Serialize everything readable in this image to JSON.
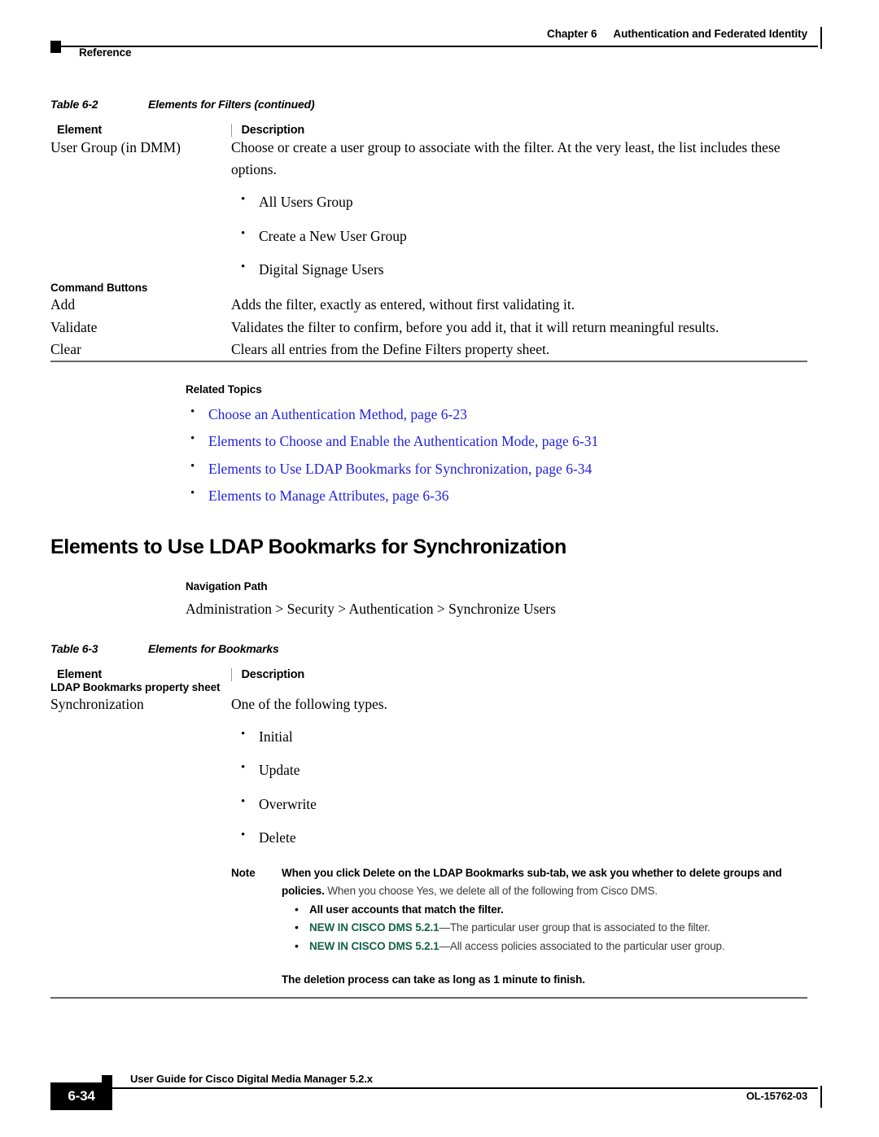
{
  "header": {
    "chapter_number": "Chapter 6",
    "chapter_title": "Authentication and Federated Identity",
    "section_label": "Reference"
  },
  "table_2": {
    "caption_number": "Table 6-2",
    "caption_title": "Elements for Filters (continued)",
    "columns": [
      "Element",
      "Description"
    ],
    "rows": [
      {
        "element": "User Group (in DMM)",
        "description": "Choose or create a user group to associate with the filter. At the very least, the list includes these options.",
        "bullets": [
          "All Users Group",
          "Create a New User Group",
          "Digital Signage Users"
        ]
      }
    ],
    "subhead": "Command Buttons",
    "command_rows": [
      {
        "element": "Add",
        "description": "Adds the filter, exactly as entered, without first validating it."
      },
      {
        "element": "Validate",
        "description": "Validates the filter to confirm, before you add it, that it will return meaningful results."
      },
      {
        "element": "Clear",
        "description": "Clears all entries from the Define Filters property sheet."
      }
    ]
  },
  "related_topics": {
    "title": "Related Topics",
    "links": [
      "Choose an Authentication Method, page 6-23",
      "Elements to Choose and Enable the Authentication Mode, page 6-31",
      "Elements to Use LDAP Bookmarks for Synchronization, page 6-34",
      "Elements to Manage Attributes, page 6-36"
    ],
    "link_color": "#2222e0"
  },
  "section": {
    "heading": "Elements to Use LDAP Bookmarks for Synchronization",
    "navpath_title": "Navigation Path",
    "navpath_value": "Administration > Security > Authentication > Synchronize Users"
  },
  "table_3": {
    "caption_number": "Table 6-3",
    "caption_title": "Elements for Bookmarks",
    "columns": [
      "Element",
      "Description"
    ],
    "subhead": "LDAP Bookmarks property sheet",
    "rows": [
      {
        "element": "Synchronization",
        "description": "One of the following types.",
        "bullets": [
          "Initial",
          "Update",
          "Overwrite",
          "Delete"
        ]
      }
    ],
    "note": {
      "label": "Note",
      "lead_bold": "When you click Delete on the LDAP Bookmarks sub-tab, we ask you whether to delete groups and policies.",
      "lead_rest": " When you choose Yes, we delete all of the following from Cisco DMS.",
      "bullets": [
        {
          "tag": "",
          "bold": "All user accounts that match the filter.",
          "rest": ""
        },
        {
          "tag": "NEW IN CISCO DMS 5.2.1",
          "bold": "",
          "rest": "—The particular user group that is associated to the filter."
        },
        {
          "tag": "NEW IN CISCO DMS 5.2.1",
          "bold": "",
          "rest": "—All access policies associated to the particular user group."
        }
      ],
      "closing": "The deletion process can take as long as 1 minute to finish.",
      "tag_color": "#14614a"
    }
  },
  "footer": {
    "page_number": "6-34",
    "guide_title": "User Guide for Cisco Digital Media Manager 5.2.x",
    "doc_id": "OL-15762-03"
  }
}
